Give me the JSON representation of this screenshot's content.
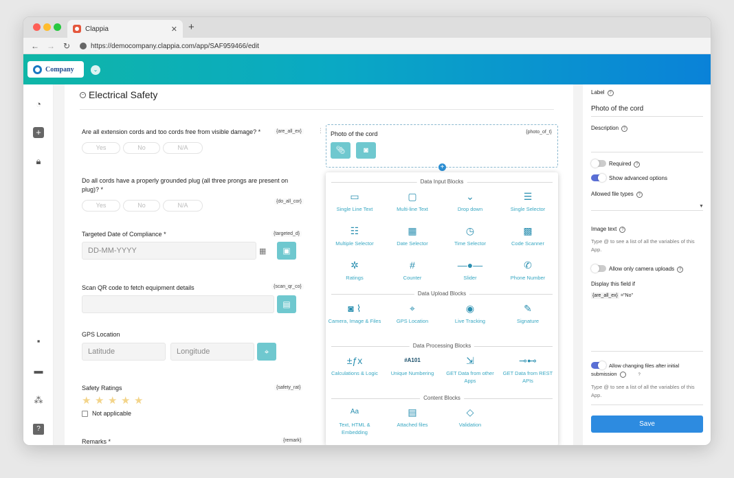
{
  "browser": {
    "tab_title": "Clappia",
    "url": "https://democompany.clappia.com/app/SAF959466/edit",
    "traffic_colors": [
      "#fe5f57",
      "#febc2e",
      "#28c840"
    ]
  },
  "app": {
    "logo_text": "Company"
  },
  "sidebar_icons": [
    "dashboard-icon",
    "add-icon",
    "lock-icon",
    "chat-icon",
    "inbox-icon",
    "workflow-icon",
    "help-icon"
  ],
  "form": {
    "section_title": "Electrical Safety",
    "q1": {
      "label": "Are all extension cords and too cords free from visible damage? *",
      "var": "{are_all_ex}",
      "options": [
        "Yes",
        "No",
        "N/A"
      ]
    },
    "q2": {
      "label": "Do all cords have a properly grounded plug (all three prongs are present on plug)? *",
      "var": "{do_all_cor}",
      "options": [
        "Yes",
        "No",
        "N/A"
      ]
    },
    "q3": {
      "label": "Targeted Date of Compliance *",
      "var": "{targeted_d}",
      "placeholder": "DD-MM-YYYY"
    },
    "q4": {
      "label": "Scan QR code to fetch equipment details",
      "var": "{scan_qr_co}"
    },
    "q5": {
      "label": "GPS Location",
      "lat": "Latitude",
      "lng": "Longitude"
    },
    "q6": {
      "label": "Safety Ratings",
      "var": "{safety_rat}",
      "na": "Not applicable",
      "rating": 0
    },
    "q7": {
      "label": "Remarks *",
      "var": "{remark}"
    },
    "photo": {
      "label": "Photo of the cord",
      "var": "{photo_of_t}"
    }
  },
  "blocks": {
    "input_header": "Data Input Blocks",
    "input": [
      "Single Line Text",
      "Multi-line Text",
      "Drop down",
      "Single Selector",
      "Multiple Selector",
      "Date Selector",
      "Time Selector",
      "Code Scanner",
      "Ratings",
      "Counter",
      "Slider",
      "Phone Number"
    ],
    "upload_header": "Data Upload Blocks",
    "upload": [
      "Camera, Image & Files",
      "GPS Location",
      "Live Tracking",
      "Signature"
    ],
    "processing_header": "Data Processing Blocks",
    "processing": [
      "Calculations & Logic",
      "Unique Numbering",
      "GET Data from other Apps",
      "GET Data from REST APIs"
    ],
    "content_header": "Content Blocks",
    "content": [
      "Text, HTML & Embedding",
      "Attached files",
      "Validation"
    ],
    "unique_code": "#A101"
  },
  "props": {
    "label_title": "Label",
    "label_value": "Photo of the cord",
    "description_title": "Description",
    "required": "Required",
    "advanced": "Show advanced options",
    "file_types": "Allowed file types",
    "image_text": "Image text",
    "image_text_hint": "Type @ to see a list of all the variables of this App.",
    "camera_only": "Allow only camera uploads",
    "display_if": "Display this field if",
    "cond_var": "{are_all_ex}",
    "cond_op": "=\"No\"",
    "allow_change": "Allow changing files after initial submission",
    "change_hint": "Type @ to see a list of all the variables of this App.",
    "save": "Save"
  }
}
